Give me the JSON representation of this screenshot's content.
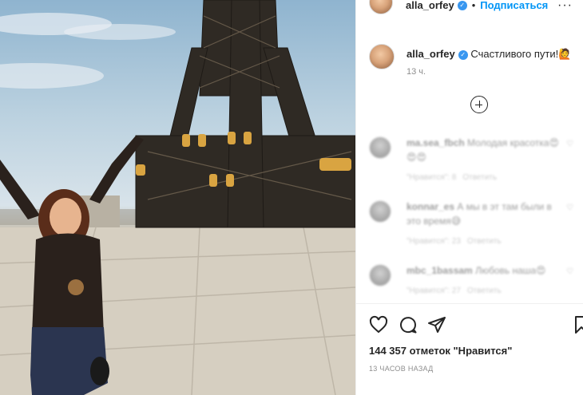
{
  "post": {
    "author": "alla_orfey",
    "follow_label": "Подписаться",
    "separator": "•",
    "more_label": "···"
  },
  "caption": {
    "username": "alla_orfey",
    "text": "Счастливого пути!🙋",
    "time": "13 ч."
  },
  "comments": [
    {
      "username": "ma.sea_fbch",
      "text": "Молодая красотка😍😍😍",
      "likes": "\"Нравится\": 8",
      "reply": "Ответить"
    },
    {
      "username": "konnar_es",
      "text": "А мы в эт там были в это время😅",
      "likes": "\"Нравится\": 23",
      "reply": "Ответить"
    },
    {
      "username": "mbc_1bassam",
      "text": "Любовь наша😍",
      "likes": "\"Нравится\": 27",
      "reply": "Ответить"
    }
  ],
  "stats": {
    "likes": "144 357 отметок \"Нравится\"",
    "ago": "13 ЧАСОВ НАЗАД"
  },
  "icons": [
    "heart-icon",
    "comment-icon",
    "share-icon",
    "bookmark-icon",
    "plus-circle-icon"
  ],
  "colors": {
    "link": "#0095f6",
    "verified": "#3897f0",
    "muted": "#8e8e8e"
  }
}
